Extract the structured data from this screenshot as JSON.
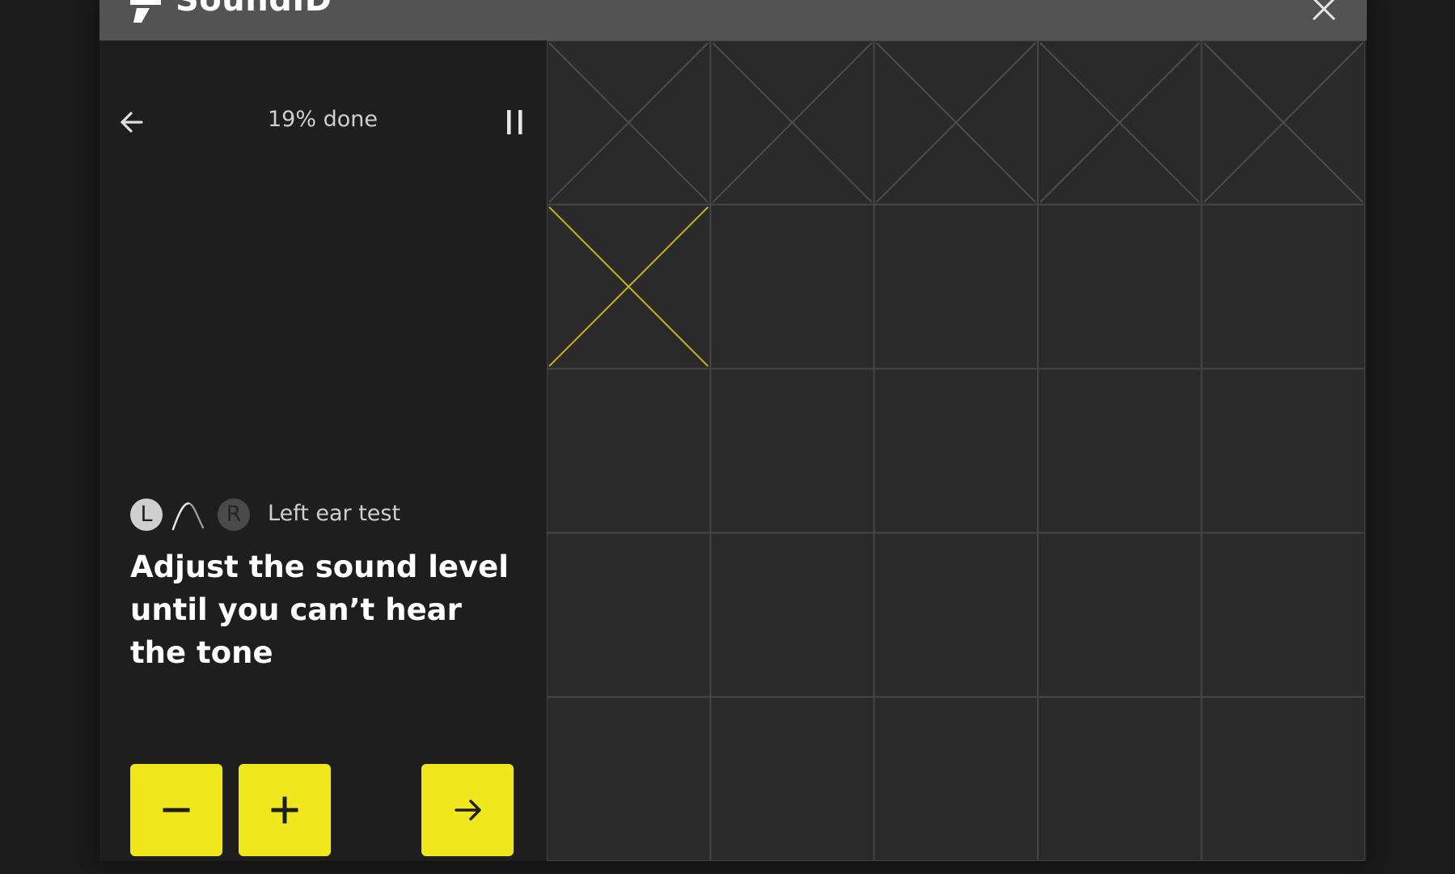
{
  "app": {
    "name": "SoundID",
    "close_icon": "close-icon",
    "logo_icon": "soundid-logo-icon"
  },
  "header": {
    "progress_text": "19% done",
    "back_icon": "arrow-left-icon",
    "pause_icon": "pause-icon"
  },
  "ear_test": {
    "left_badge": "L",
    "right_badge": "R",
    "label": "Left ear test",
    "wave_icon": "tone-wave-icon"
  },
  "instruction": {
    "text": "Adjust the sound level until you can’t hear the tone"
  },
  "controls": {
    "decrease_icon": "minus-icon",
    "increase_icon": "plus-icon",
    "next_icon": "arrow-right-icon"
  },
  "colors": {
    "accent": "#f0e81c",
    "titlebar": "#535353",
    "panel": "#1e1e1e",
    "grid_bg": "#2a2a2a",
    "grid_line": "#444444",
    "completed_cross": "#4c4c4c",
    "active_cross": "#c2b41a"
  },
  "grid": {
    "rows": 5,
    "columns": 5,
    "cells": [
      "completed",
      "completed",
      "completed",
      "completed",
      "completed",
      "active",
      "empty",
      "empty",
      "empty",
      "empty",
      "empty",
      "empty",
      "empty",
      "empty",
      "empty",
      "empty",
      "empty",
      "empty",
      "empty",
      "empty",
      "empty",
      "empty",
      "empty",
      "empty",
      "empty"
    ]
  }
}
